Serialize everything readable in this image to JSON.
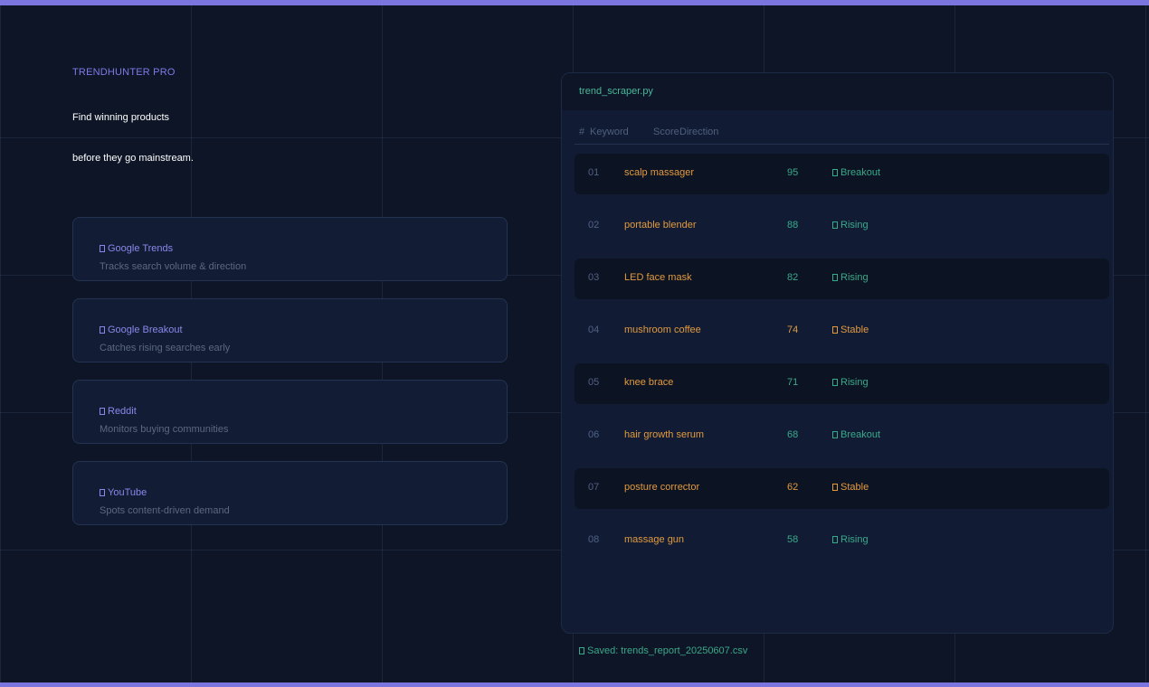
{
  "brand": "TRENDHUNTER PRO",
  "headline": [
    "Find winning products",
    "before they go mainstream."
  ],
  "sources": [
    {
      "title": "Google Trends",
      "desc": "Tracks search volume & direction",
      "icon": "source-icon"
    },
    {
      "title": "Google Breakout",
      "desc": "Catches rising searches early",
      "icon": "source-icon"
    },
    {
      "title": "Reddit",
      "desc": "Monitors buying communities",
      "icon": "source-icon"
    },
    {
      "title": "YouTube",
      "desc": "Spots content-driven demand",
      "icon": "source-icon"
    }
  ],
  "panel": {
    "filename": "trend_scraper.py",
    "columns": {
      "num": "#",
      "keyword": "Keyword",
      "score": "Score",
      "direction": "Direction"
    },
    "rows": [
      {
        "num": "01",
        "keyword": "scalp massager",
        "score": "95",
        "direction": "Breakout"
      },
      {
        "num": "02",
        "keyword": "portable blender",
        "score": "88",
        "direction": "Rising"
      },
      {
        "num": "03",
        "keyword": "LED face mask",
        "score": "82",
        "direction": "Rising"
      },
      {
        "num": "04",
        "keyword": "mushroom coffee",
        "score": "74",
        "direction": "Stable"
      },
      {
        "num": "05",
        "keyword": "knee brace",
        "score": "71",
        "direction": "Rising"
      },
      {
        "num": "06",
        "keyword": "hair growth serum",
        "score": "68",
        "direction": "Breakout"
      },
      {
        "num": "07",
        "keyword": "posture corrector",
        "score": "62",
        "direction": "Stable"
      },
      {
        "num": "08",
        "keyword": "massage gun",
        "score": "58",
        "direction": "Rising"
      }
    ]
  },
  "status": "Saved: trends_report_20250607.csv",
  "colors": {
    "accent": "#7b75e0",
    "green": "#3aa98a",
    "orange": "#e29a3f",
    "background": "#0d1526"
  }
}
